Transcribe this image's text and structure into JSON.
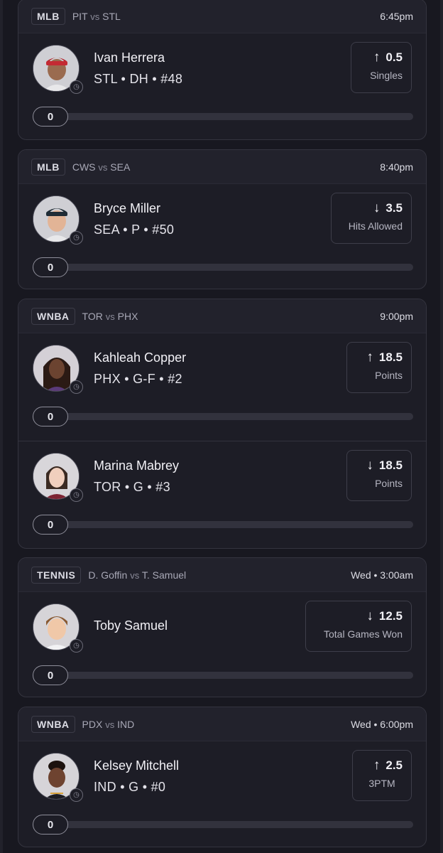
{
  "games": [
    {
      "league": "MLB",
      "team_a": "PIT",
      "vs": "vs",
      "team_b": "STL",
      "time": "6:45pm",
      "players": [
        {
          "name": "Ivan Herrera",
          "meta": "STL • DH • #48",
          "direction": "up",
          "arrow": "↑",
          "line": "0.5",
          "stat": "Singles",
          "progress": "0"
        }
      ]
    },
    {
      "league": "MLB",
      "team_a": "CWS",
      "vs": "vs",
      "team_b": "SEA",
      "time": "8:40pm",
      "players": [
        {
          "name": "Bryce Miller",
          "meta": "SEA • P • #50",
          "direction": "down",
          "arrow": "↓",
          "line": "3.5",
          "stat": "Hits Allowed",
          "progress": "0"
        }
      ]
    },
    {
      "league": "WNBA",
      "team_a": "TOR",
      "vs": "vs",
      "team_b": "PHX",
      "time": "9:00pm",
      "players": [
        {
          "name": "Kahleah Copper",
          "meta": "PHX • G-F • #2",
          "direction": "up",
          "arrow": "↑",
          "line": "18.5",
          "stat": "Points",
          "progress": "0"
        },
        {
          "name": "Marina Mabrey",
          "meta": "TOR • G • #3",
          "direction": "down",
          "arrow": "↓",
          "line": "18.5",
          "stat": "Points",
          "progress": "0"
        }
      ]
    },
    {
      "league": "TENNIS",
      "team_a": "D. Goffin",
      "vs": "vs",
      "team_b": "T. Samuel",
      "time": "Wed • 3:00am",
      "players": [
        {
          "name": "Toby Samuel",
          "meta": "",
          "direction": "down",
          "arrow": "↓",
          "line": "12.5",
          "stat": "Total Games Won",
          "progress": "0"
        }
      ]
    },
    {
      "league": "WNBA",
      "team_a": "PDX",
      "vs": "vs",
      "team_b": "IND",
      "time": "Wed • 6:00pm",
      "players": [
        {
          "name": "Kelsey Mitchell",
          "meta": "IND • G • #0",
          "direction": "up",
          "arrow": "↑",
          "line": "2.5",
          "stat": "3PTM",
          "progress": "0"
        }
      ]
    }
  ],
  "colors": {
    "background": "#181820",
    "card": "#1d1d26",
    "card_header": "#22222c",
    "border": "#34343f",
    "track": "#32323d"
  }
}
